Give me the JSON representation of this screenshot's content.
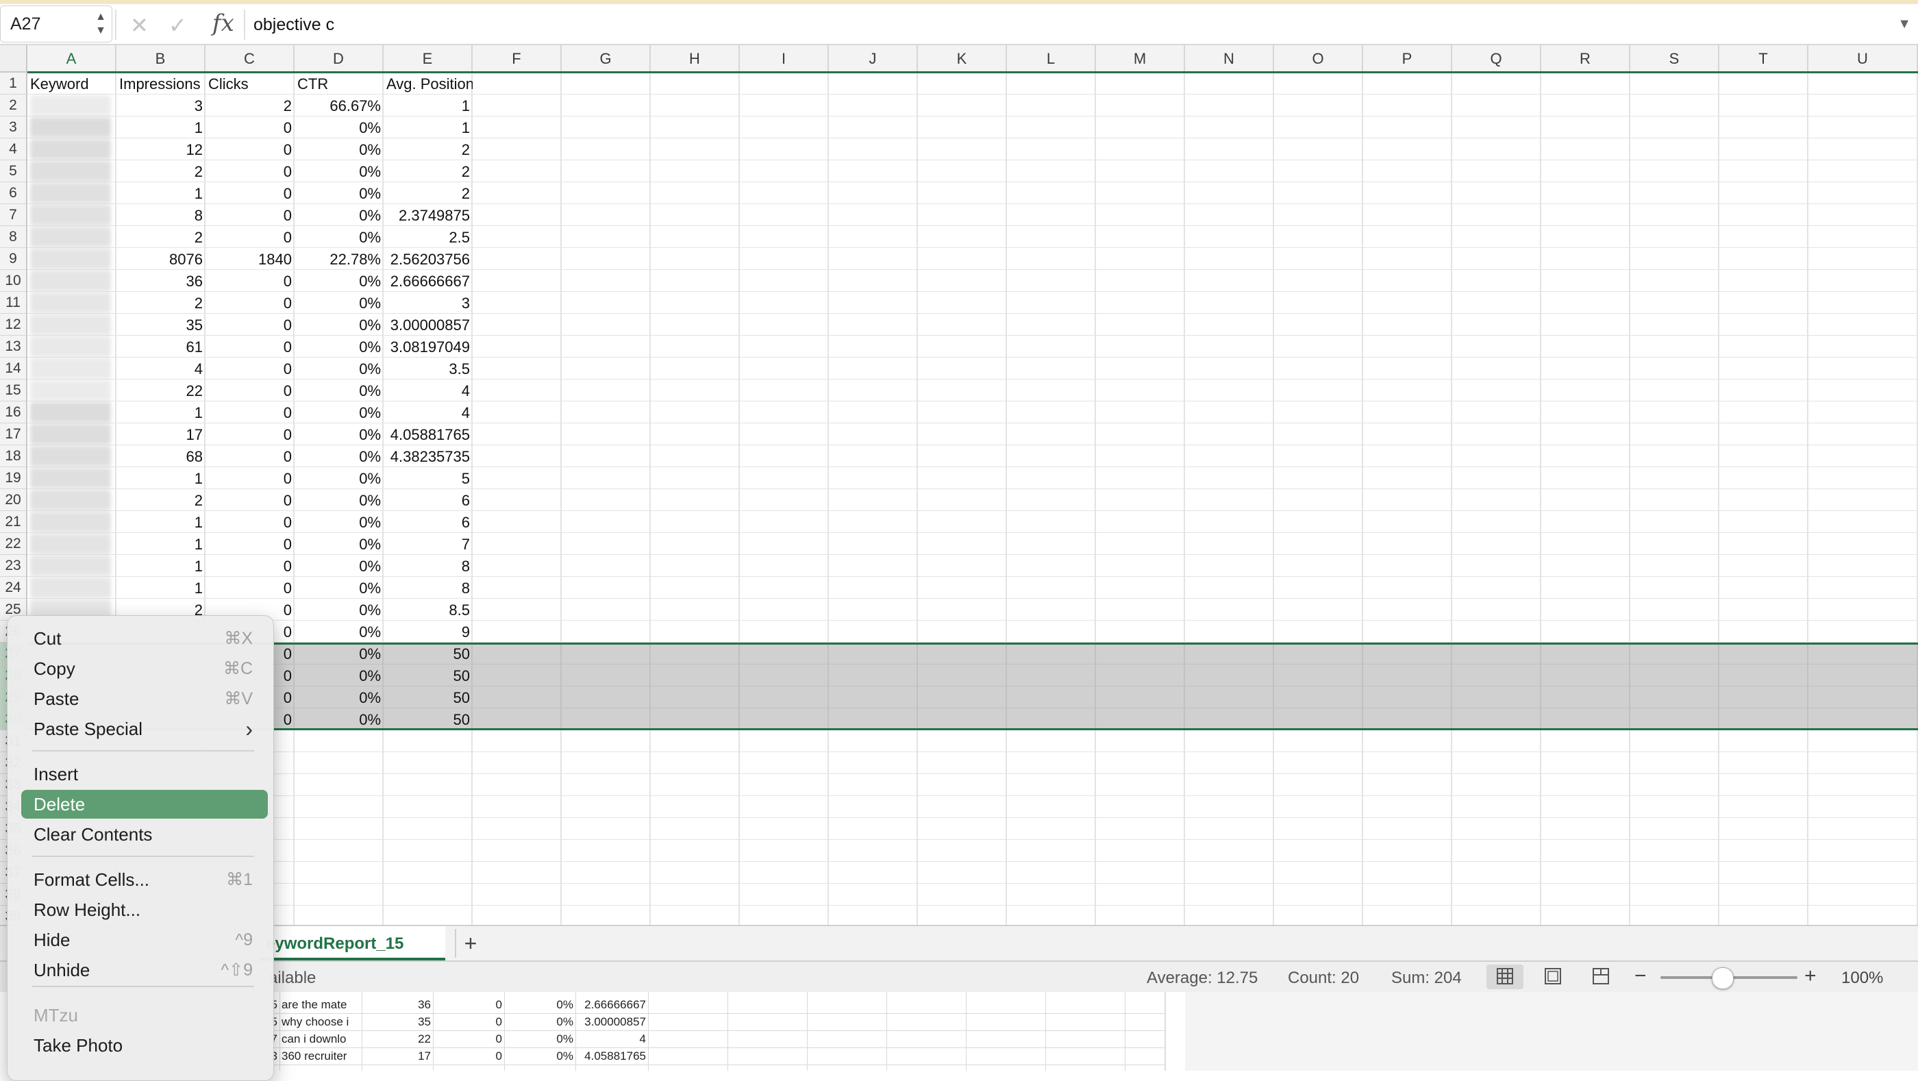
{
  "formula_bar": {
    "cell_ref": "A27",
    "cancel_icon": "cross-icon",
    "confirm_icon": "checkmark-icon",
    "fx_label": "fx",
    "content": "objective c"
  },
  "sheet": {
    "columns": [
      "A",
      "B",
      "C",
      "D",
      "E",
      "F",
      "G",
      "H",
      "I",
      "J",
      "K",
      "L",
      "M",
      "N",
      "O",
      "P",
      "Q",
      "R",
      "S",
      "T",
      "U"
    ],
    "row_numbers": [
      "1",
      "2",
      "3",
      "4",
      "5",
      "6",
      "7",
      "8",
      "9",
      "10",
      "11",
      "12",
      "13",
      "14",
      "15",
      "16",
      "17",
      "18",
      "19",
      "20",
      "21",
      "22",
      "23",
      "24",
      "25",
      "26",
      "27",
      "28",
      "29",
      "30",
      "31",
      "32",
      "33",
      "34",
      "35",
      "36",
      "37",
      "38",
      "39"
    ],
    "header_row": [
      "Keyword",
      "Impressions",
      "Clicks",
      "CTR",
      "Avg. Position"
    ],
    "rows": [
      [
        "3",
        "2",
        "66.67%",
        "1"
      ],
      [
        "1",
        "0",
        "0%",
        "1"
      ],
      [
        "12",
        "0",
        "0%",
        "2"
      ],
      [
        "2",
        "0",
        "0%",
        "2"
      ],
      [
        "1",
        "0",
        "0%",
        "2"
      ],
      [
        "8",
        "0",
        "0%",
        "2.3749875"
      ],
      [
        "2",
        "0",
        "0%",
        "2.5"
      ],
      [
        "8076",
        "1840",
        "22.78%",
        "2.56203756"
      ],
      [
        "36",
        "0",
        "0%",
        "2.66666667"
      ],
      [
        "2",
        "0",
        "0%",
        "3"
      ],
      [
        "35",
        "0",
        "0%",
        "3.00000857"
      ],
      [
        "61",
        "0",
        "0%",
        "3.08197049"
      ],
      [
        "4",
        "0",
        "0%",
        "3.5"
      ],
      [
        "22",
        "0",
        "0%",
        "4"
      ],
      [
        "1",
        "0",
        "0%",
        "4"
      ],
      [
        "17",
        "0",
        "0%",
        "4.05881765"
      ],
      [
        "68",
        "0",
        "0%",
        "4.38235735"
      ],
      [
        "1",
        "0",
        "0%",
        "5"
      ],
      [
        "2",
        "0",
        "0%",
        "6"
      ],
      [
        "1",
        "0",
        "0%",
        "6"
      ],
      [
        "1",
        "0",
        "0%",
        "7"
      ],
      [
        "1",
        "0",
        "0%",
        "8"
      ],
      [
        "1",
        "0",
        "0%",
        "8"
      ],
      [
        "2",
        "0",
        "0%",
        "8.5"
      ],
      [
        "",
        "0",
        "0%",
        "9"
      ],
      [
        "",
        "0",
        "0%",
        "50"
      ],
      [
        "",
        "0",
        "0%",
        "50"
      ],
      [
        "",
        "0",
        "0%",
        "50"
      ],
      [
        "",
        "0",
        "0%",
        "50"
      ]
    ],
    "selected_rows": [
      "27",
      "28",
      "29",
      "30"
    ]
  },
  "tabs": {
    "active_label": "eywordReport_15",
    "add_label": "+"
  },
  "status": {
    "left_text": "ailable",
    "average": "Average: 12.75",
    "count": "Count: 20",
    "sum": "Sum: 204",
    "zoom_minus": "−",
    "zoom_plus": "+",
    "zoom": "100%",
    "zoom_fraction": 0.45
  },
  "background_window": {
    "rows": [
      [
        "5",
        "are the mate",
        "36",
        "0",
        "0%",
        "2.66666667"
      ],
      [
        "5",
        "why choose i",
        "35",
        "0",
        "0%",
        "3.00000857"
      ],
      [
        "7",
        "can i downlo",
        "22",
        "0",
        "0%",
        "4"
      ],
      [
        "3",
        "360 recruiter",
        "17",
        "0",
        "0%",
        "4.05881765"
      ]
    ]
  },
  "context_menu": {
    "items": [
      {
        "label": "Cut",
        "shortcut": "⌘X"
      },
      {
        "label": "Copy",
        "shortcut": "⌘C"
      },
      {
        "label": "Paste",
        "shortcut": "⌘V"
      },
      {
        "label": "Paste Special",
        "shortcut": "›"
      },
      {
        "label": "Insert",
        "shortcut": ""
      },
      {
        "label": "Delete",
        "shortcut": ""
      },
      {
        "label": "Clear Contents",
        "shortcut": ""
      },
      {
        "label": "Format Cells...",
        "shortcut": "⌘1"
      },
      {
        "label": "Row Height...",
        "shortcut": ""
      },
      {
        "label": "Hide",
        "shortcut": "^9"
      },
      {
        "label": "Unhide",
        "shortcut": "^⇧9"
      },
      {
        "label": "MTzu",
        "shortcut": ""
      },
      {
        "label": "Take Photo",
        "shortcut": ""
      }
    ]
  },
  "colors": {
    "accent": "#217346",
    "menu_highlight": "#5f9e72",
    "selection": "#a6a6a6"
  }
}
